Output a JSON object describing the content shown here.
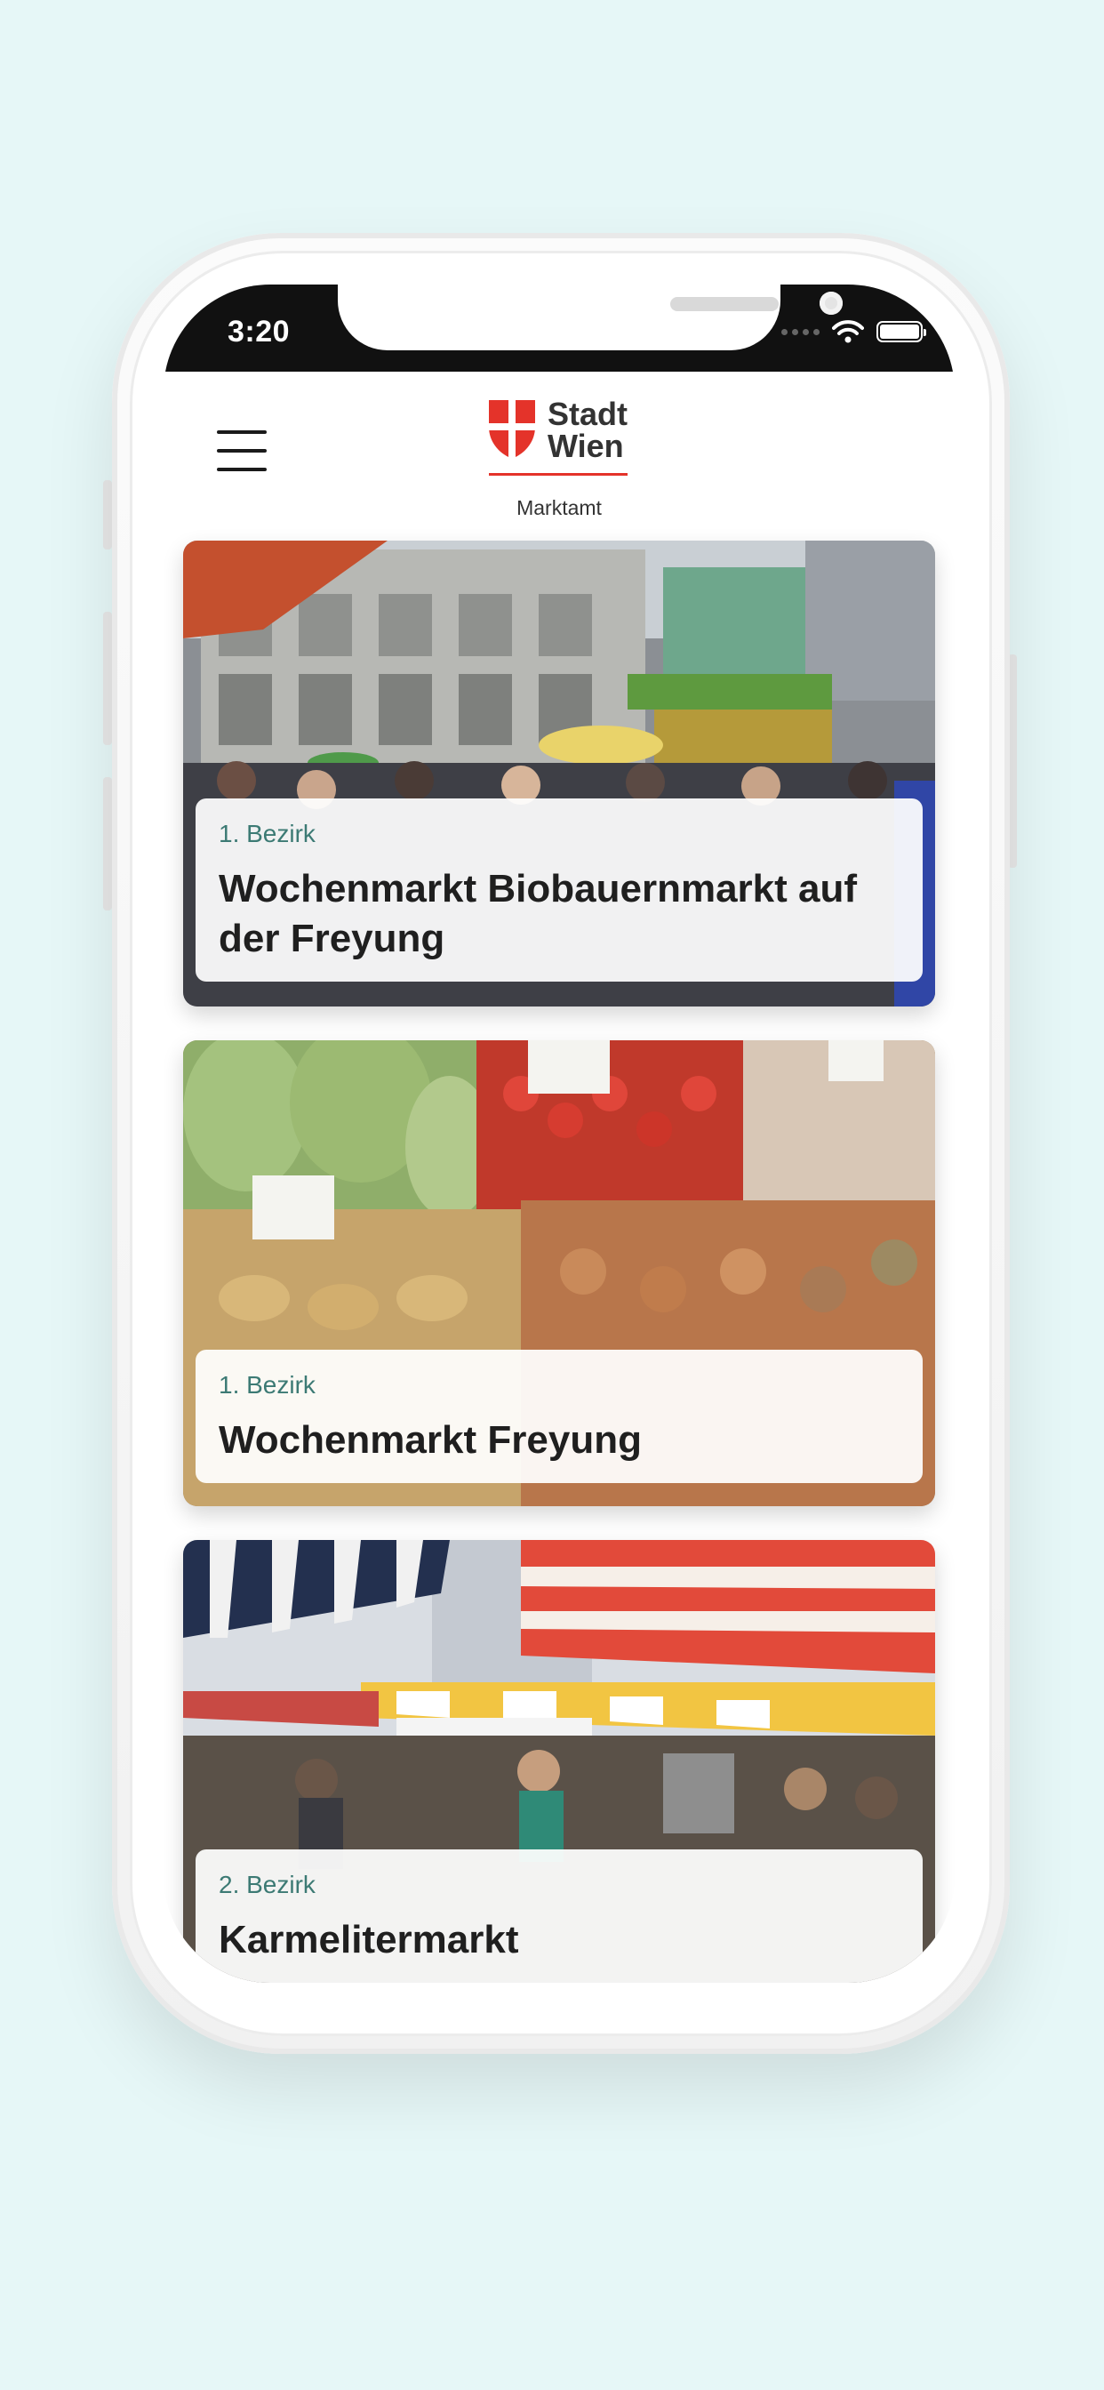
{
  "status_bar": {
    "time": "3:20"
  },
  "header": {
    "logo_line1": "Stadt",
    "logo_line2": "Wien",
    "subtitle": "Marktamt"
  },
  "markets": [
    {
      "district": "1. Bezirk",
      "title": "Wochenmarkt Biobauernmarkt auf der Freyung"
    },
    {
      "district": "1. Bezirk",
      "title": "Wochenmarkt Freyung"
    },
    {
      "district": "2. Bezirk",
      "title": "Karmelitermarkt"
    }
  ],
  "icons": {
    "menu": "hamburger-menu-icon",
    "logo": "vienna-shield-logo",
    "wifi": "wifi-icon",
    "battery": "battery-icon",
    "signal": "cellular-signal-icon"
  },
  "colors": {
    "background": "#e6f7f7",
    "brand_red": "#e4332a",
    "district_text": "#3c7a74",
    "status_bar": "#111111"
  }
}
